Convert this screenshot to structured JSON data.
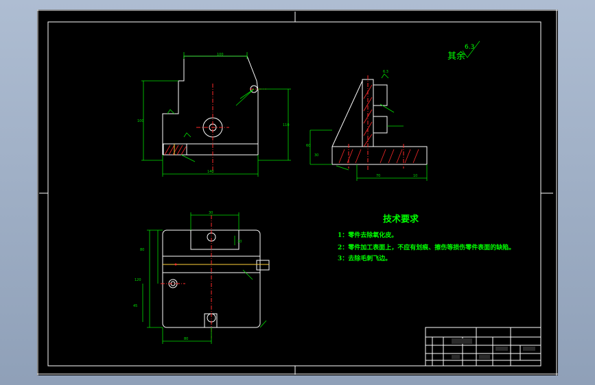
{
  "drawing": {
    "background": "#000000",
    "line_color": "#ffffff",
    "dimension_color": "#00e000",
    "centerline_color": "#ff2a2a",
    "text_color": "#00ff00"
  },
  "roughness_note": {
    "label": "其余",
    "value": "6.3"
  },
  "tech_requirements": {
    "title": "技术要求",
    "items": [
      "1：零件去除氧化皮。",
      "2：零件加工表面上，不应有划痕、擦伤等损伤零件表面的缺陷。",
      "3：去除毛刺飞边。"
    ]
  },
  "dimensions": {
    "front_width_top": "100",
    "front_height": "100",
    "front_height_right": "110",
    "front_width_bottom": "140",
    "side_left_height": "60",
    "side_bottom_left": "30",
    "side_bottom_right": "70",
    "side_right": "10",
    "side_tag": "6.3",
    "plan_top": "30",
    "plan_left": "80",
    "plan_height": "120",
    "plan_bottom": "80",
    "plan_mid_left": "45",
    "plan_small": "30"
  }
}
